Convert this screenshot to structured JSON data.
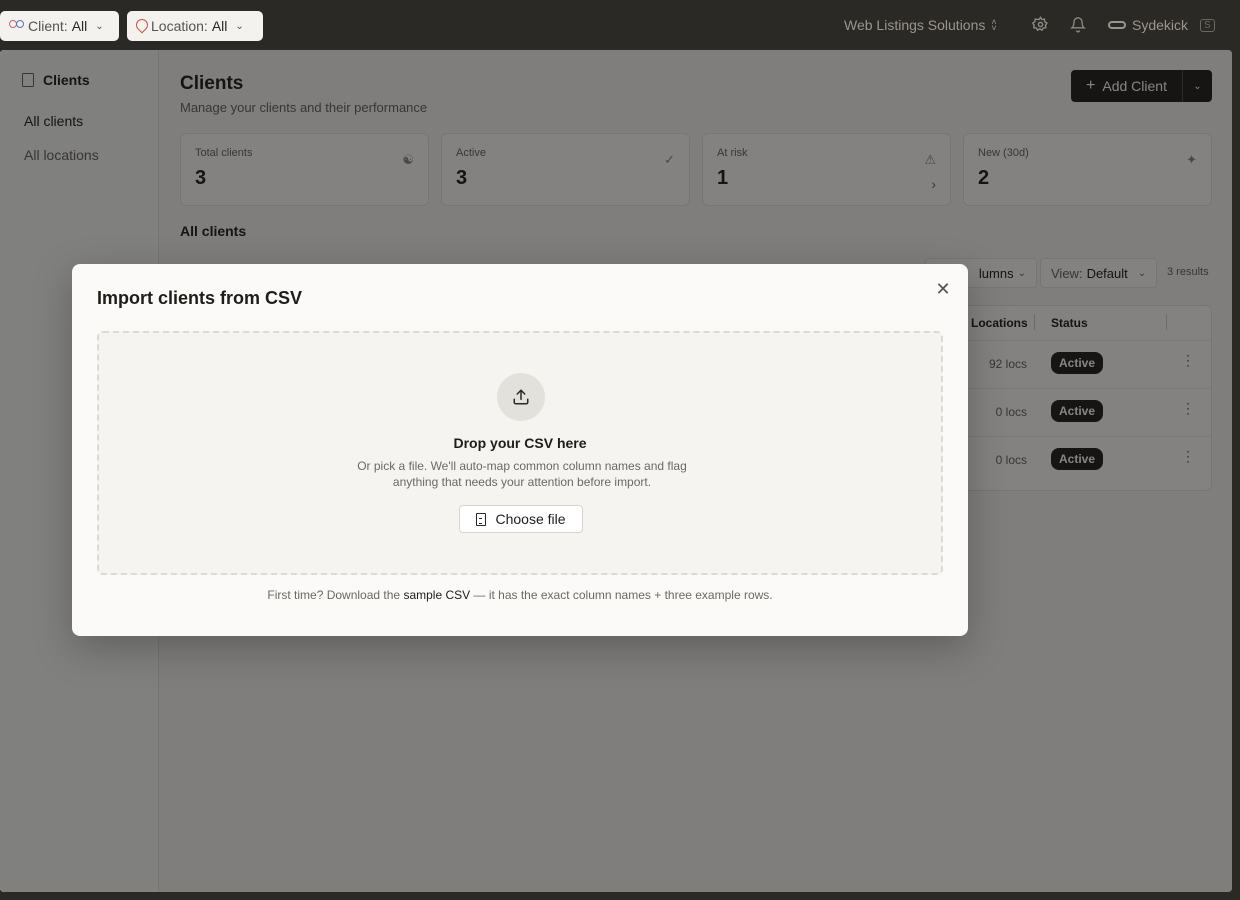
{
  "topbar": {
    "client_filter": {
      "key": "Client:",
      "value": "All"
    },
    "location_filter": {
      "key": "Location:",
      "value": "All"
    },
    "org_name": "Web Listings Solutions",
    "brand": "Sydekick",
    "brand_shortcut": "S"
  },
  "sidebar": {
    "heading": "Clients",
    "items": [
      {
        "label": "All clients"
      },
      {
        "label": "All locations"
      }
    ]
  },
  "page": {
    "title": "Clients",
    "subtitle": "Manage your clients and their performance",
    "add_button": "Add Client"
  },
  "stats": [
    {
      "label": "Total clients",
      "value": "3",
      "icon": "users-icon"
    },
    {
      "label": "Active",
      "value": "3",
      "icon": "check-circle-icon"
    },
    {
      "label": "At risk",
      "value": "1",
      "icon": "warning-icon"
    },
    {
      "label": "New (30d)",
      "value": "2",
      "icon": "sparkle-icon"
    }
  ],
  "table_section": {
    "title": "All clients",
    "columns_button": "lumns",
    "view_key": "View:",
    "view_value": "Default",
    "results": "3 results",
    "headers": {
      "locations": "Locations",
      "status": "Status"
    },
    "rows": [
      {
        "locations": "92 locs",
        "status": "Active"
      },
      {
        "locations": "0 locs",
        "status": "Active"
      },
      {
        "locations": "0 locs",
        "status": "Active"
      }
    ]
  },
  "modal": {
    "title": "Import clients from CSV",
    "dropzone_title": "Drop your CSV here",
    "dropzone_desc": "Or pick a file. We'll auto-map common column names and flag anything that needs your attention before import.",
    "choose_button": "Choose file",
    "footnote_pre": "First time? Download the",
    "footnote_link": "sample CSV",
    "footnote_post": "— it has the exact column names + three example rows."
  },
  "colors": {
    "primary_dark": "#2c2a27",
    "surface": "#fbfaf8",
    "background": "#f3f2ef"
  }
}
